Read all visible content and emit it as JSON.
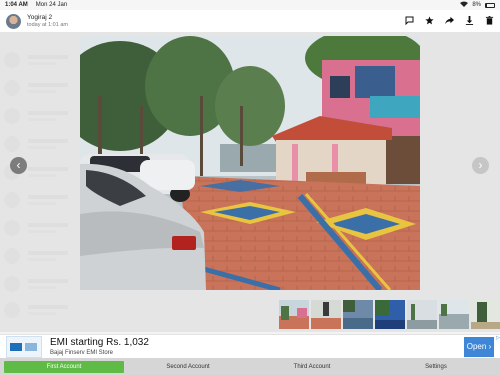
{
  "status_bar": {
    "time": "1:04 AM",
    "date": "Mon 24 Jan",
    "battery": "8%"
  },
  "header": {
    "sender_name": "Yogiraj 2",
    "timestamp": "today at 1:01 am",
    "actions": [
      "chat-icon",
      "star-icon",
      "share-icon",
      "download-icon",
      "delete-icon"
    ]
  },
  "thumbnails": [
    "thumb-1",
    "thumb-2",
    "thumb-3",
    "thumb-4",
    "thumb-5",
    "thumb-6",
    "thumb-7"
  ],
  "ad": {
    "headline": "EMI starting Rs. 1,032",
    "advertiser": "Bajaj Finserv EMI Store",
    "cta": "Open",
    "cta_symbol": "›"
  },
  "tabs": [
    {
      "label": "First Account",
      "active": true
    },
    {
      "label": "Second Account",
      "active": false
    },
    {
      "label": "Third Account",
      "active": false
    },
    {
      "label": "Settings",
      "active": false
    }
  ],
  "colors": {
    "active_tab": "#5fbb45",
    "cta": "#3f86d6"
  }
}
